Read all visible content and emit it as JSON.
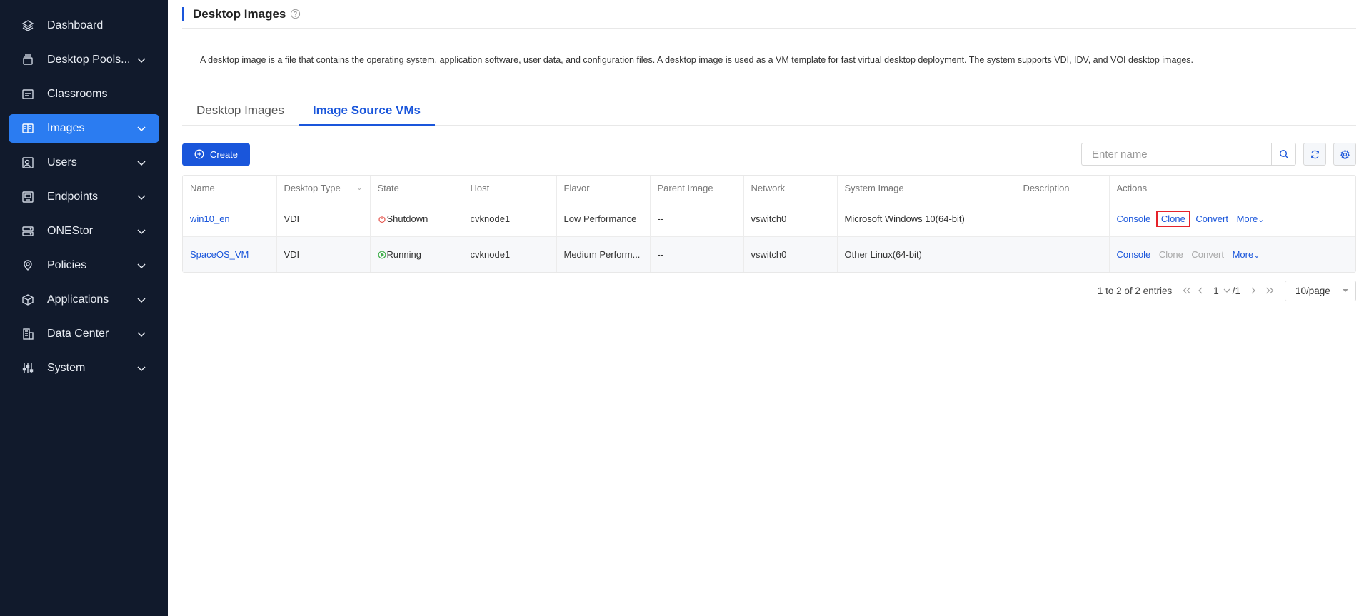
{
  "sidebar": {
    "items": [
      {
        "label": "Dashboard",
        "icon": "layers-icon",
        "has_children": false,
        "active": false
      },
      {
        "label": "Desktop Pools...",
        "icon": "desktop-pool-icon",
        "has_children": true,
        "active": false
      },
      {
        "label": "Classrooms",
        "icon": "classroom-icon",
        "has_children": false,
        "active": false
      },
      {
        "label": "Images",
        "icon": "images-icon",
        "has_children": true,
        "active": true
      },
      {
        "label": "Users",
        "icon": "user-icon",
        "has_children": true,
        "active": false
      },
      {
        "label": "Endpoints",
        "icon": "endpoint-icon",
        "has_children": true,
        "active": false
      },
      {
        "label": "ONEStor",
        "icon": "storage-icon",
        "has_children": true,
        "active": false
      },
      {
        "label": "Policies",
        "icon": "policy-icon",
        "has_children": true,
        "active": false
      },
      {
        "label": "Applications",
        "icon": "package-icon",
        "has_children": true,
        "active": false
      },
      {
        "label": "Data Center",
        "icon": "building-icon",
        "has_children": true,
        "active": false
      },
      {
        "label": "System",
        "icon": "sliders-icon",
        "has_children": true,
        "active": false
      }
    ]
  },
  "header": {
    "title": "Desktop Images",
    "description": "A desktop image is a file that contains the operating system, application software, user data, and configuration files. A desktop image is used as a VM template for fast virtual desktop deployment. The system supports VDI, IDV, and VOI desktop images."
  },
  "tabs": [
    {
      "label": "Desktop Images",
      "active": false
    },
    {
      "label": "Image Source VMs",
      "active": true
    }
  ],
  "toolbar": {
    "create_label": "Create",
    "search_placeholder": "Enter name"
  },
  "table": {
    "columns": [
      "Name",
      "Desktop Type",
      "State",
      "Host",
      "Flavor",
      "Parent Image",
      "Network",
      "System Image",
      "Description",
      "Actions"
    ],
    "rows": [
      {
        "name": "win10_en",
        "desktop_type": "VDI",
        "state": "Shutdown",
        "host": "cvknode1",
        "flavor": "Low Performance",
        "parent_image": "--",
        "network": "vswitch0",
        "system_image": "Microsoft Windows 10(64-bit)",
        "description": "",
        "actions": {
          "console": "Console",
          "clone": "Clone",
          "convert": "Convert",
          "more": "More"
        }
      },
      {
        "name": "SpaceOS_VM",
        "desktop_type": "VDI",
        "state": "Running",
        "host": "cvknode1",
        "flavor": "Medium Perform...",
        "parent_image": "--",
        "network": "vswitch0",
        "system_image": "Other Linux(64-bit)",
        "description": "",
        "actions": {
          "console": "Console",
          "clone": "Clone",
          "convert": "Convert",
          "more": "More"
        }
      }
    ]
  },
  "pager": {
    "total_text": "1 to 2 of 2 entries",
    "current_page": "1",
    "total_pages": "/1",
    "page_size": "10/page"
  },
  "colors": {
    "sidebar_bg": "#111a2c",
    "active_nav": "#2b7cf1",
    "primary": "#1a56db",
    "highlight_border": "#e5232a",
    "shutdown": "#e5534b",
    "running": "#3fae4a"
  }
}
